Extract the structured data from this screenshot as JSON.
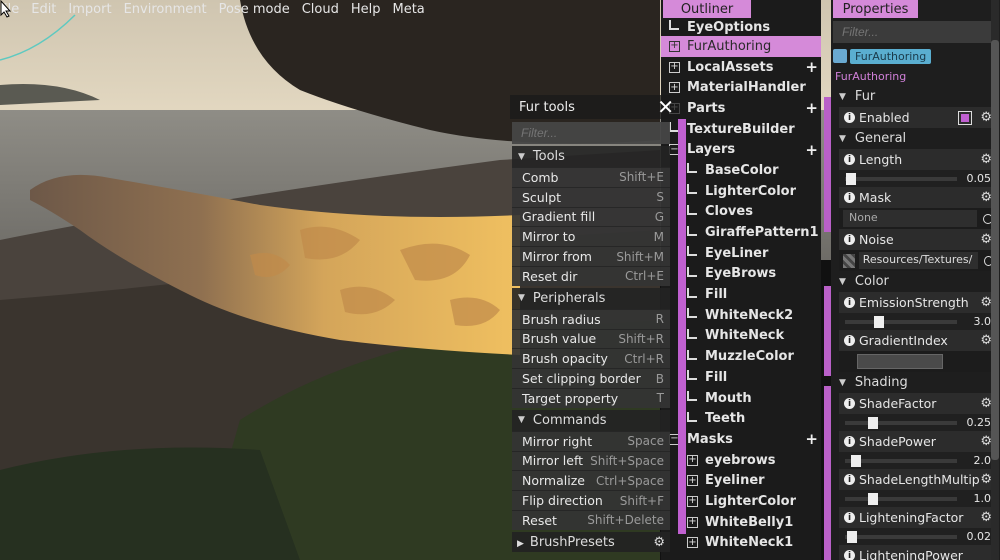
{
  "menu": [
    "File",
    "Edit",
    "Import",
    "Environment",
    "Pose mode",
    "Cloud",
    "Help",
    "Meta"
  ],
  "menu_first_visible": "ile",
  "fur_tools": {
    "title": "Fur tools",
    "filter_placeholder": "Filter...",
    "sections": [
      {
        "title": "Tools",
        "items": [
          {
            "label": "Comb",
            "key": "Shift+E"
          },
          {
            "label": "Sculpt",
            "key": "S"
          },
          {
            "label": "Gradient fill",
            "key": "G"
          },
          {
            "label": "Mirror to",
            "key": "M"
          },
          {
            "label": "Mirror from",
            "key": "Shift+M"
          },
          {
            "label": "Reset dir",
            "key": "Ctrl+E"
          }
        ]
      },
      {
        "title": "Peripherals",
        "items": [
          {
            "label": "Brush radius",
            "key": "R"
          },
          {
            "label": "Brush value",
            "key": "Shift+R"
          },
          {
            "label": "Brush opacity",
            "key": "Ctrl+R"
          },
          {
            "label": "Set clipping border",
            "key": "B"
          },
          {
            "label": "Target property",
            "key": "T"
          }
        ]
      },
      {
        "title": "Commands",
        "items": [
          {
            "label": "Mirror right",
            "key": "Space"
          },
          {
            "label": "Mirror left",
            "key": "Shift+Space"
          },
          {
            "label": "Normalize",
            "key": "Ctrl+Space"
          },
          {
            "label": "Flip direction",
            "key": "Shift+F"
          },
          {
            "label": "Reset",
            "key": "Shift+Delete"
          }
        ]
      }
    ],
    "brush_presets": "BrushPresets"
  },
  "outliner": {
    "tab": "Outliner",
    "rows": [
      {
        "label": "EyeOptions",
        "indent": 0,
        "icon": "tick",
        "plus": false,
        "sel": false
      },
      {
        "label": "FurAuthoring",
        "indent": 0,
        "icon": "plus-box",
        "plus": false,
        "sel": true
      },
      {
        "label": "LocalAssets",
        "indent": 0,
        "icon": "plus-box",
        "plus": true,
        "sel": false
      },
      {
        "label": "MaterialHandler",
        "indent": 0,
        "icon": "plus-box",
        "plus": false,
        "sel": false
      },
      {
        "label": "Parts",
        "indent": 0,
        "icon": "plus-box",
        "plus": true,
        "sel": false
      },
      {
        "label": "TextureBuilder",
        "indent": 0,
        "icon": "tick",
        "plus": false,
        "sel": false
      },
      {
        "label": "Layers",
        "indent": 0,
        "icon": "minus-box",
        "plus": true,
        "sel": false
      },
      {
        "label": "BaseColor",
        "indent": 1,
        "icon": "tick",
        "plus": false,
        "sel": false
      },
      {
        "label": "LighterColor",
        "indent": 1,
        "icon": "tick",
        "plus": false,
        "sel": false
      },
      {
        "label": "Cloves",
        "indent": 1,
        "icon": "tick",
        "plus": false,
        "sel": false
      },
      {
        "label": "GiraffePattern1",
        "indent": 1,
        "icon": "tick",
        "plus": false,
        "sel": false
      },
      {
        "label": "EyeLiner",
        "indent": 1,
        "icon": "tick",
        "plus": false,
        "sel": false
      },
      {
        "label": "EyeBrows",
        "indent": 1,
        "icon": "tick",
        "plus": false,
        "sel": false
      },
      {
        "label": "Fill",
        "indent": 1,
        "icon": "tick",
        "plus": false,
        "sel": false
      },
      {
        "label": "WhiteNeck2",
        "indent": 1,
        "icon": "tick",
        "plus": false,
        "sel": false
      },
      {
        "label": "WhiteNeck",
        "indent": 1,
        "icon": "tick",
        "plus": false,
        "sel": false
      },
      {
        "label": "MuzzleColor",
        "indent": 1,
        "icon": "tick",
        "plus": false,
        "sel": false
      },
      {
        "label": "Fill",
        "indent": 1,
        "icon": "tick",
        "plus": false,
        "sel": false
      },
      {
        "label": "Mouth",
        "indent": 1,
        "icon": "tick",
        "plus": false,
        "sel": false
      },
      {
        "label": "Teeth",
        "indent": 1,
        "icon": "tick",
        "plus": false,
        "sel": false
      },
      {
        "label": "Masks",
        "indent": 0,
        "icon": "minus-box",
        "plus": true,
        "sel": false
      },
      {
        "label": "eyebrows",
        "indent": 1,
        "icon": "plus-box",
        "plus": false,
        "sel": false
      },
      {
        "label": "Eyeliner",
        "indent": 1,
        "icon": "plus-box",
        "plus": false,
        "sel": false
      },
      {
        "label": "LighterColor",
        "indent": 1,
        "icon": "plus-box",
        "plus": false,
        "sel": false
      },
      {
        "label": "WhiteBelly1",
        "indent": 1,
        "icon": "plus-box",
        "plus": false,
        "sel": false
      },
      {
        "label": "WhiteNeck1",
        "indent": 1,
        "icon": "plus-box",
        "plus": false,
        "sel": false
      }
    ]
  },
  "properties": {
    "tab": "Properties",
    "filter_placeholder": "Filter...",
    "tag": "FurAuthoring",
    "subtitle": "FurAuthoring",
    "fur_section": "Fur",
    "enabled_label": "Enabled",
    "general_section": "General",
    "length_label": "Length",
    "length_value": "0.05",
    "length_fraction": 0.05,
    "mask_label": "Mask",
    "mask_value": "None",
    "noise_label": "Noise",
    "noise_value": "Resources/Textures/",
    "color_section": "Color",
    "emission_label": "EmissionStrength",
    "emission_value": "3.0",
    "emission_fraction": 0.3,
    "gradient_label": "GradientIndex",
    "shading_section": "Shading",
    "shadefactor_label": "ShadeFactor",
    "shadefactor_value": "0.25",
    "shadefactor_fraction": 0.25,
    "shadepower_label": "ShadePower",
    "shadepower_value": "2.0",
    "shadepower_fraction": 0.1,
    "shadelength_label": "ShadeLengthMultip",
    "shadelength_value": "1.0",
    "shadelength_fraction": 0.25,
    "lightening_label": "LighteningFactor",
    "lightening_value": "0.02",
    "lightening_fraction": 0.06,
    "lighteningpower_label": "LighteningPower"
  },
  "colors": {
    "accent": "#d58ad9",
    "accent_bar": "#b960c8",
    "tag": "#5aaed0"
  }
}
